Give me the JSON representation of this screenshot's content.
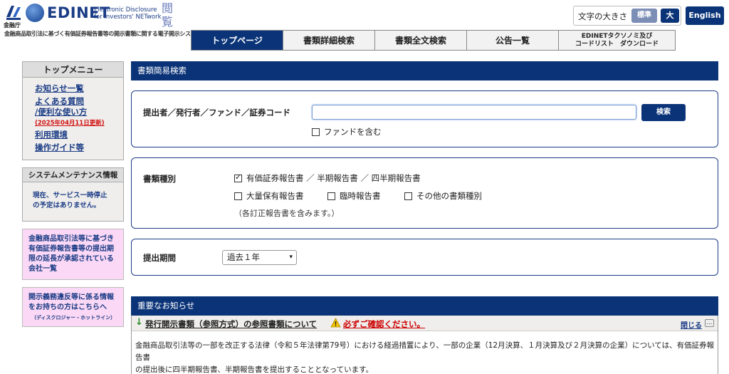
{
  "header": {
    "fsa_label": "金融庁",
    "logo_word": "EDINET",
    "logo_sub_line1": "Electronic Disclosure",
    "logo_sub_line2": "for Investors' NETwork",
    "logo_etsuran": "閲覧",
    "tagline": "金融商品取引法に基づく有価証券報告書等の開示書類に関する電子開示システム",
    "font_size_label": "文字の大きさ",
    "font_standard": "標準",
    "font_large": "大",
    "english": "English"
  },
  "nav": {
    "tabs": [
      {
        "label": "トップページ"
      },
      {
        "label": "書類詳細検索"
      },
      {
        "label": "書類全文検索"
      },
      {
        "label": "公告一覧"
      },
      {
        "line1": "EDINETタクソノミ及び",
        "line2": "コードリスト　ダウンロード"
      }
    ]
  },
  "sidebar": {
    "top_menu_title": "トップメニュー",
    "items": [
      {
        "label": "お知らせ一覧"
      },
      {
        "label": "よくある質問"
      },
      {
        "label": "/便利な使い方"
      },
      {
        "label": "利用環境"
      },
      {
        "label": "操作ガイド等"
      }
    ],
    "updated": "(2025年04月11日更新)",
    "maintenance_title": "システムメンテナンス情報",
    "maintenance_line1": "現在、サービス一時停止",
    "maintenance_line2": "の予定はありません。",
    "pink1_lines": [
      "金融商品取引法等に基づき",
      "有価証券報告書等の提出期",
      "限の延長が承認されている",
      "会社一覧"
    ],
    "pink2_lines": [
      "開示義務違反等に係る情報",
      "をお持ちの方はこちらへ"
    ],
    "pink2_small": "（ディスクロジャー・ホットライン）"
  },
  "search": {
    "section_title": "書類簡易検索",
    "submitter_label": "提出者／発行者／ファンド／証券コード",
    "input_value": "",
    "search_button": "検索",
    "include_fund": "ファンドを含む",
    "include_fund_checked": false,
    "doc_type_label": "書類種別",
    "doc_types": [
      {
        "label": "有価証券報告書 ／ 半期報告書 ／ 四半期報告書",
        "checked": true
      },
      {
        "label": "大量保有報告書",
        "checked": false
      },
      {
        "label": "臨時報告書",
        "checked": false
      },
      {
        "label": "その他の書類種別",
        "checked": false
      }
    ],
    "doc_note": "（各訂正報告書を含みます。）",
    "period_label": "提出期間",
    "period_value": "過去１年"
  },
  "notice": {
    "section_title": "重要なお知らせ",
    "item_title": "発行開示書類（参照方式）の参照書類について",
    "warning": "必ずご確認ください。",
    "close": "閉じる",
    "more": "…",
    "body_line1": "金融商品取引法等の一部を改正する法律（令和５年法律第79号）における経過措置により、一部の企業（12月決算、１月決算及び２月決算の企業）については、有価証券報告書",
    "body_line2": "の提出後に四半期報告書、半期報告書を提出することとなっています。"
  },
  "colors": {
    "navy": "#0b3478",
    "link": "#1b3c86",
    "pink": "#fbd8f5",
    "warning_red": "#cc0000"
  }
}
